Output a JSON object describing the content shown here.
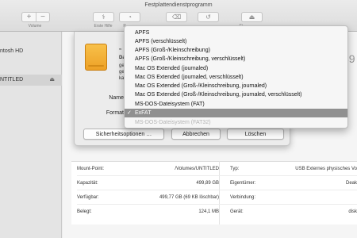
{
  "window": {
    "title": "Festplattendienstprogramm"
  },
  "toolbar": {
    "volume_label": "Volume",
    "volume_add": "+",
    "volume_remove": "−",
    "first_aid_label": "Erste Hilfe",
    "partition_label": "P",
    "erase_label": "",
    "restore_label": "",
    "unmount_label": "Ei"
  },
  "sidebar": {
    "items": [
      {
        "label": "ntosh HD"
      },
      {
        "label": "NTITLED",
        "eject": "⏏"
      }
    ]
  },
  "main": {
    "capacity_partial": "39"
  },
  "sheet": {
    "title_partial": "„",
    "desc_line1": "Da",
    "desc_line2": "ge",
    "desc_line3": "ge",
    "desc_line4": "ka",
    "name_label": "Name",
    "format_label": "Format",
    "security_button": "Sicherheitsoptionen …",
    "cancel_button": "Abbrechen",
    "erase_button": "Löschen"
  },
  "format_menu": {
    "items": [
      {
        "label": "APFS",
        "state": "normal"
      },
      {
        "label": "APFS (verschlüsselt)",
        "state": "normal"
      },
      {
        "label": "APFS (Groß-/Kleinschreibung)",
        "state": "normal"
      },
      {
        "label": "APFS (Groß-/Kleinschreibung, verschlüsselt)",
        "state": "normal"
      },
      {
        "label": "Mac OS Extended (journaled)",
        "state": "normal"
      },
      {
        "label": "Mac OS Extended (journaled, verschlüsselt)",
        "state": "normal"
      },
      {
        "label": "Mac OS Extended (Groß-/Kleinschreibung, journaled)",
        "state": "normal"
      },
      {
        "label": "Mac OS Extended (Groß-/Kleinschreibung, journaled, verschlüsselt)",
        "state": "normal"
      },
      {
        "label": "MS-DOS-Dateisystem (FAT)",
        "state": "normal"
      },
      {
        "label": "ExFAT",
        "state": "selected",
        "check": "✓"
      },
      {
        "label": "MS-DOS-Dateisystem (FAT32)",
        "state": "disabled"
      }
    ]
  },
  "info": {
    "left": [
      {
        "key": "Mount-Point:",
        "value": "/Volumes/UNTITLED"
      },
      {
        "key": "Kapazität:",
        "value": "499,89 GB"
      },
      {
        "key": "Verfügbar:",
        "value": "499,77 GB (69 KB löschbar)"
      },
      {
        "key": "Belegt:",
        "value": "124,1 MB"
      }
    ],
    "right": [
      {
        "key": "Typ:",
        "value": "USB Externes physisches Vo"
      },
      {
        "key": "Eigentümer:",
        "value": "Deak"
      },
      {
        "key": "Verbindung:",
        "value": ""
      },
      {
        "key": "Gerät:",
        "value": "disk"
      }
    ]
  }
}
